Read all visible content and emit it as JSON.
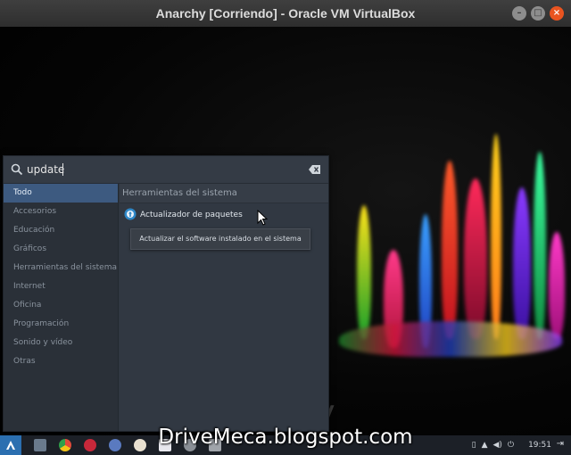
{
  "window": {
    "title": "Anarchy [Corriendo] - Oracle VM VirtualBox",
    "minimize_glyph": "–",
    "maximize_glyph": "□",
    "close_glyph": "×"
  },
  "launcher": {
    "search": {
      "value": "update"
    },
    "categories": [
      "Todo",
      "Accesorios",
      "Educación",
      "Gráficos",
      "Herramientas del sistema",
      "Internet",
      "Oficina",
      "Programación",
      "Sonido y vídeo",
      "Otras"
    ],
    "selected_category": "Todo",
    "section_header": "Herramientas del sistema",
    "results": [
      {
        "label": "Actualizador de paquetes",
        "icon": "package-update-icon"
      }
    ],
    "tooltip": "Actualizar el software instalado en el sistema"
  },
  "taskbar": {
    "clock": "19:51",
    "apps": [
      "files-icon",
      "chrome-icon",
      "mail-icon",
      "browser-icon",
      "media-player-icon",
      "text-editor-icon",
      "settings-icon",
      "terminal-icon"
    ]
  },
  "watermark": "DriveMeca.blogspot.com",
  "colors": {
    "accent": "#3d5a80",
    "menu_bg": "#2f3640",
    "taskbar_bg": "#1c2027",
    "close_button": "#e95420"
  }
}
